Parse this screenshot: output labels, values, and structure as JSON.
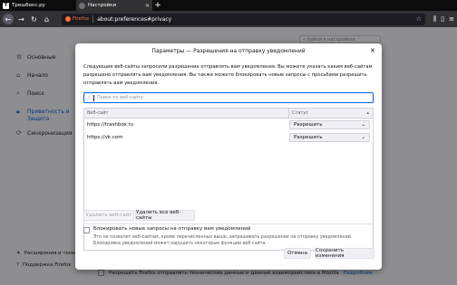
{
  "tabs": [
    {
      "label": "Трешбокс.ру",
      "favicon": "trashbox-favicon",
      "active": false
    },
    {
      "label": "Настройки",
      "favicon": "firefox-icon",
      "active": true
    }
  ],
  "navbar": {
    "identity_label": "Firefox",
    "url": "about:preferences#privacy"
  },
  "page": {
    "find_placeholder": "Найти в настройках",
    "categories": [
      {
        "label": "Основные",
        "icon": "gear-icon"
      },
      {
        "label": "Начало",
        "icon": "home-icon"
      },
      {
        "label": "Поиск",
        "icon": "search-icon"
      },
      {
        "label": "Приватность и Защита",
        "icon": "lock-icon",
        "selected": true
      },
      {
        "label": "Синхронизация",
        "icon": "sync-icon"
      }
    ],
    "bottom_links": [
      {
        "label": "Расширения и темы",
        "icon": "puzzle-icon"
      },
      {
        "label": "Поддержка Firefox",
        "icon": "help-icon"
      }
    ],
    "telemetry_text": "Разрешить Firefox отправлять технические данные и данные взаимодействия в Mozilla",
    "telemetry_link": "Подробнее"
  },
  "dialog": {
    "title": "Параметры — Разрешения на отправку уведомлений",
    "description": "Следующие веб-сайты запросили разрешение отправлять вам уведомления. Вы можете указать каким веб-сайтам разрешено отправлять вам уведомления. Вы также можете блокировать новые запросы с просьбами разрешить отправлять вам уведомления.",
    "search_placeholder": "Поиск по веб-сайту",
    "columns": {
      "site": "Веб-сайт",
      "status": "Статус"
    },
    "rows": [
      {
        "site": "https://trashbox.ru",
        "status": "Разрешить"
      },
      {
        "site": "https://vk.com",
        "status": "Разрешить"
      }
    ],
    "remove_site_label": "Удалить веб-сайт",
    "remove_all_label": "Удалить все веб-сайты",
    "block_new_label": "Блокировать новые запросы на отправку вам уведомлений",
    "block_new_desc": "Это не позволит веб-сайтам, кроме перечисленных выше, запрашивать разрешение на отправку уведомлений. Блокировка уведомлений может нарушить некоторые функции веб-сайта.",
    "cancel_label": "Отмена",
    "save_label": "Сохранить изменения"
  }
}
